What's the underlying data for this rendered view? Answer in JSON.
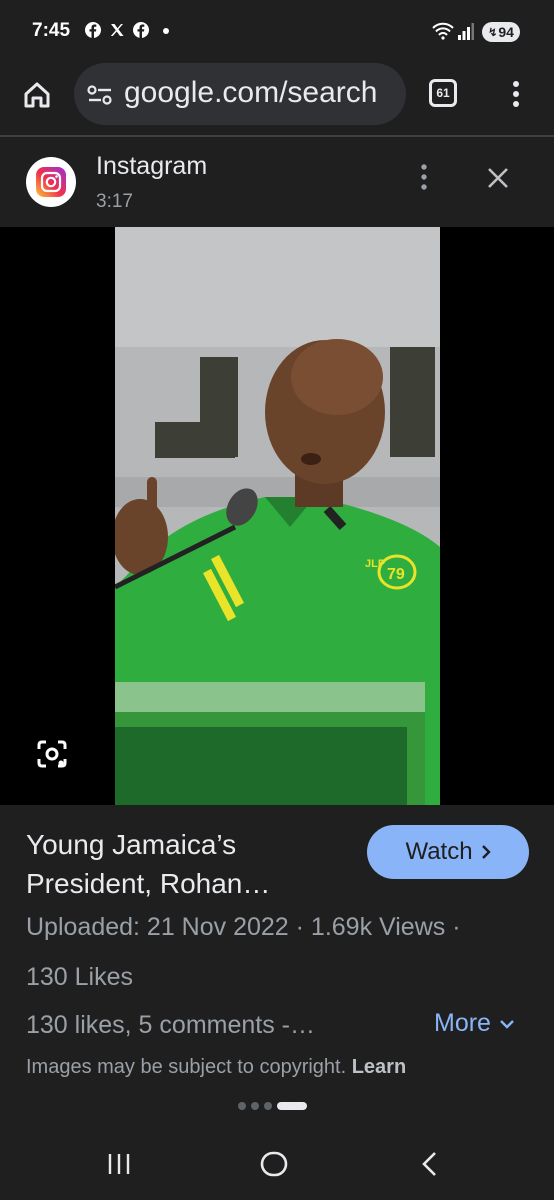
{
  "status_bar": {
    "time": "7:45",
    "battery": "94",
    "icons": [
      "facebook-icon",
      "x-icon",
      "facebook-icon",
      "dot-icon",
      "wifi-icon",
      "signal-icon",
      "battery-icon"
    ]
  },
  "browser": {
    "url": "google.com/search",
    "tab_count": "61"
  },
  "source": {
    "name": "Instagram",
    "duration": "3:17"
  },
  "result": {
    "title": "Young Jamaica’s President, Rohan…",
    "watch_label": "Watch",
    "meta": "Uploaded: 21 Nov 2022 · 1.69k Views ·",
    "likes": "130 Likes",
    "caption": "130 likes, 5 comments -…",
    "more_label": "More",
    "copyright_text": "Images may be subject to copyright.",
    "learn_label": "Learn"
  },
  "photo": {
    "logo_text": "JLP",
    "badge_text": "79"
  },
  "colors": {
    "background": "#1f1f1f",
    "accent": "#8ab4f8",
    "shirt_green": "#2fae3f"
  }
}
